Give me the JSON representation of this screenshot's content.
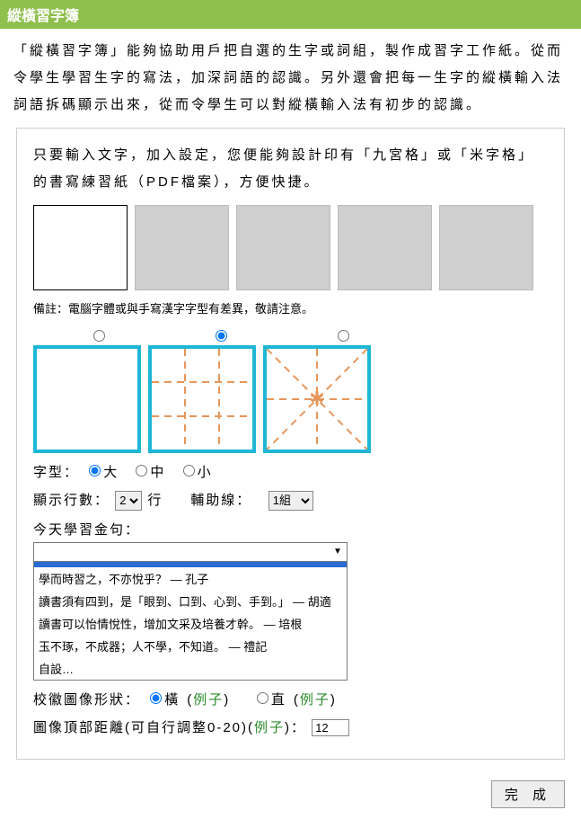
{
  "header": {
    "title": "縱橫習字簿"
  },
  "intro": "「縱橫習字簿」能夠協助用戶把自選的生字或詞組，製作成習字工作紙。從而令學生學習生字的寫法，加深詞語的認識。另外還會把每一生字的縱橫輸入法詞語拆碼顯示出來，從而令學生可以對縱橫輸入法有初步的認識。",
  "panel": {
    "lead": "只要輸入文字，加入設定，您便能夠設計印有「九宮格」或「米字格」的書寫練習紙（PDF檔案），方便快捷。",
    "note": "備註：電腦字體或與手寫漢字字型有差異，敬請注意。",
    "font_size": {
      "label": "字型：",
      "opts": [
        "大",
        "中",
        "小"
      ]
    },
    "rows": {
      "label": "顯示行數：",
      "value": "2",
      "unit": "行"
    },
    "guides": {
      "label": "輔助線：",
      "value": "1組"
    },
    "golden": {
      "label": "今天學習金句：",
      "options": [
        "",
        "學而時習之，不亦悅乎？ — 孔子",
        "讀書須有四到，是「眼到、口到、心到、手到。」 — 胡適",
        "讀書可以怡情悅性，增加文采及培養才幹。 — 培根",
        "玉不琢，不成器；人不學，不知道。 — 禮記",
        "自設…"
      ]
    },
    "logo_shape": {
      "label": "校徽圖像形狀：",
      "h": "橫",
      "v": "直",
      "ex": "例子"
    },
    "top_dist": {
      "label": "圖像頂部距離(可自行調整0-20)",
      "ex": "例子",
      "value": "12"
    },
    "done": "完 成"
  }
}
